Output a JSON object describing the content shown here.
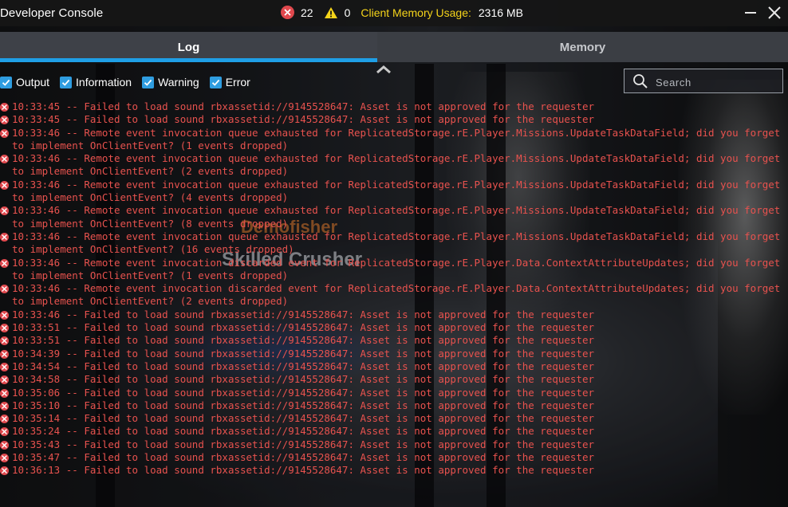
{
  "window": {
    "title": "Developer Console",
    "error_count": "22",
    "warning_count": "0",
    "memory_label": "Client Memory Usage:",
    "memory_value": "2316 MB"
  },
  "tabs": [
    {
      "label": "Log",
      "active": true
    },
    {
      "label": "Memory",
      "active": false
    }
  ],
  "filters": [
    {
      "label": "Output",
      "checked": true
    },
    {
      "label": "Information",
      "checked": true
    },
    {
      "label": "Warning",
      "checked": true
    },
    {
      "label": "Error",
      "checked": true
    }
  ],
  "search": {
    "placeholder": "Search",
    "value": ""
  },
  "background_text": {
    "line1": "Demofisher",
    "line2": "Skilled Crusher"
  },
  "colors": {
    "error": "#e8524e",
    "accent": "#1f9fe6",
    "memory_label": "#f4d31a"
  },
  "log": [
    {
      "time": "10:33:45",
      "message": "Failed to load sound rbxassetid://9145528647: Asset is not approved for the requester"
    },
    {
      "time": "10:33:45",
      "message": "Failed to load sound rbxassetid://9145528647: Asset is not approved for the requester"
    },
    {
      "time": "10:33:46",
      "message": "Remote event invocation queue exhausted for ReplicatedStorage.rE.Player.Missions.UpdateTaskDataField; did you forget to implement OnClientEvent? (1 events dropped)"
    },
    {
      "time": "10:33:46",
      "message": "Remote event invocation queue exhausted for ReplicatedStorage.rE.Player.Missions.UpdateTaskDataField; did you forget to implement OnClientEvent? (2 events dropped)"
    },
    {
      "time": "10:33:46",
      "message": "Remote event invocation queue exhausted for ReplicatedStorage.rE.Player.Missions.UpdateTaskDataField; did you forget to implement OnClientEvent? (4 events dropped)"
    },
    {
      "time": "10:33:46",
      "message": "Remote event invocation queue exhausted for ReplicatedStorage.rE.Player.Missions.UpdateTaskDataField; did you forget to implement OnClientEvent? (8 events dropped)"
    },
    {
      "time": "10:33:46",
      "message": "Remote event invocation queue exhausted for ReplicatedStorage.rE.Player.Missions.UpdateTaskDataField; did you forget to implement OnClientEvent? (16 events dropped)"
    },
    {
      "time": "10:33:46",
      "message": "Remote event invocation discarded event for ReplicatedStorage.rE.Player.Data.ContextAttributeUpdates; did you forget to implement OnClientEvent? (1 events dropped)"
    },
    {
      "time": "10:33:46",
      "message": "Remote event invocation discarded event for ReplicatedStorage.rE.Player.Data.ContextAttributeUpdates; did you forget to implement OnClientEvent? (2 events dropped)"
    },
    {
      "time": "10:33:46",
      "message": "Failed to load sound rbxassetid://9145528647: Asset is not approved for the requester"
    },
    {
      "time": "10:33:51",
      "message": "Failed to load sound rbxassetid://9145528647: Asset is not approved for the requester"
    },
    {
      "time": "10:33:51",
      "message": "Failed to load sound rbxassetid://9145528647: Asset is not approved for the requester"
    },
    {
      "time": "10:34:39",
      "message": "Failed to load sound rbxassetid://9145528647: Asset is not approved for the requester"
    },
    {
      "time": "10:34:54",
      "message": "Failed to load sound rbxassetid://9145528647: Asset is not approved for the requester"
    },
    {
      "time": "10:34:58",
      "message": "Failed to load sound rbxassetid://9145528647: Asset is not approved for the requester"
    },
    {
      "time": "10:35:06",
      "message": "Failed to load sound rbxassetid://9145528647: Asset is not approved for the requester"
    },
    {
      "time": "10:35:10",
      "message": "Failed to load sound rbxassetid://9145528647: Asset is not approved for the requester"
    },
    {
      "time": "10:35:14",
      "message": "Failed to load sound rbxassetid://9145528647: Asset is not approved for the requester"
    },
    {
      "time": "10:35:24",
      "message": "Failed to load sound rbxassetid://9145528647: Asset is not approved for the requester"
    },
    {
      "time": "10:35:43",
      "message": "Failed to load sound rbxassetid://9145528647: Asset is not approved for the requester"
    },
    {
      "time": "10:35:47",
      "message": "Failed to load sound rbxassetid://9145528647: Asset is not approved for the requester"
    },
    {
      "time": "10:36:13",
      "message": "Failed to load sound rbxassetid://9145528647: Asset is not approved for the requester"
    }
  ]
}
